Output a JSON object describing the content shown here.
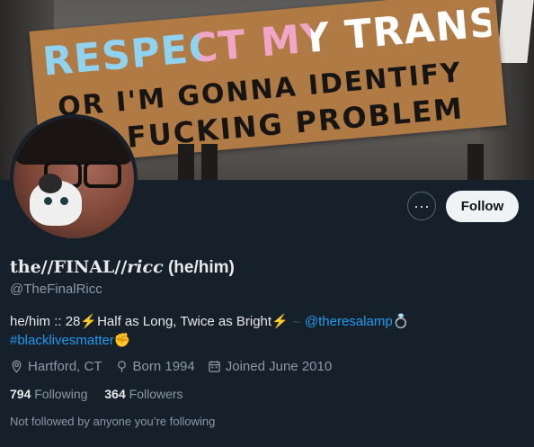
{
  "banner": {
    "sign_line1": "RESPECT MY TRANS HOMIES",
    "sign_line2": "OR I'M GONNA IDENTIFY",
    "sign_line3": "A FUCKING PROBLEM"
  },
  "actions": {
    "more_icon": "···",
    "follow_label": "Follow"
  },
  "profile": {
    "name_part1": "the//FINAL//",
    "name_part2": "ricc",
    "name_part3": " (he/him)",
    "handle": "@TheFinalRicc",
    "bio": {
      "text1": "he/him :: 28",
      "bolt": "⚡",
      "text2": "Half as Long, Twice as Bright",
      "faint": "  ∼ ",
      "mention": "@theresalamp",
      "ring": "💍",
      "hashtag": "#blacklivesmatter",
      "fist": "✊"
    },
    "location": "Hartford, CT",
    "born": "Born 1994",
    "joined": "Joined June 2010",
    "following_count": "794",
    "following_label": "Following",
    "followers_count": "364",
    "followers_label": "Followers",
    "not_followed": "Not followed by anyone you’re following"
  },
  "colors": {
    "background": "#15202b",
    "link": "#1d9bf0",
    "muted": "#8b98a5",
    "follow_button_bg": "#eff3f4"
  },
  "icons": [
    "location-icon",
    "born-icon",
    "calendar-icon",
    "more-icon"
  ]
}
